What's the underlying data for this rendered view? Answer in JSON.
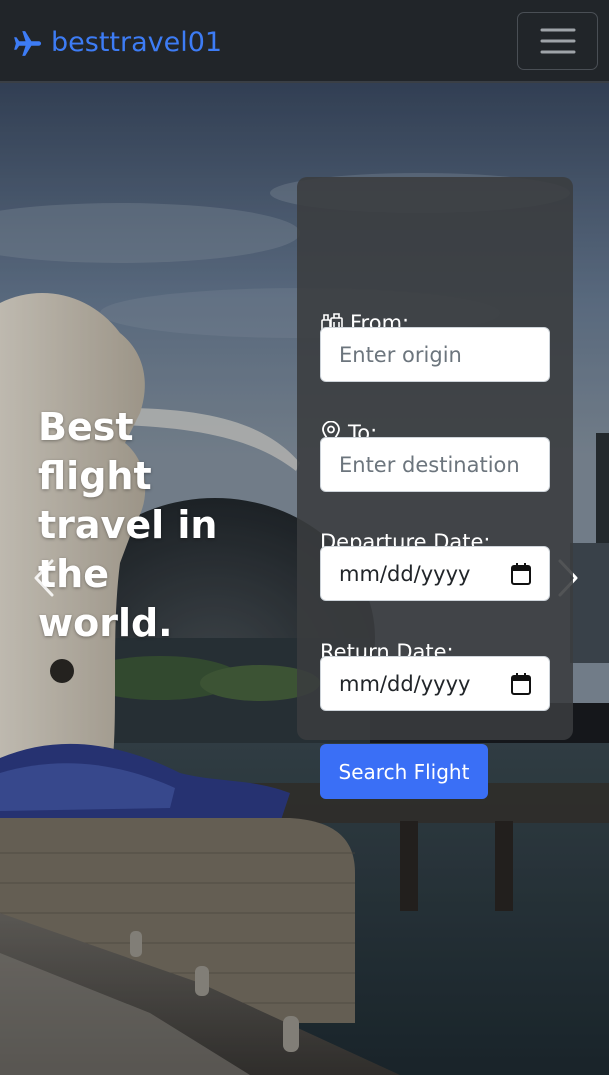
{
  "navbar": {
    "brand_text": "besttravel01",
    "brand_icon": "plane-icon",
    "toggler_icon": "hamburger-menu-icon",
    "brand_color": "#3d7cf5",
    "background": "#212529"
  },
  "hero": {
    "tagline": "Best flight travel in the world.",
    "prev_icon": "chevron-left-icon",
    "next_icon": "chevron-right-icon"
  },
  "search_form": {
    "from": {
      "label": "From:",
      "icon": "luggage-icon",
      "placeholder": "Enter origin"
    },
    "to": {
      "label": "To:",
      "icon": "location-pin-icon",
      "placeholder": "Enter destination"
    },
    "departure": {
      "label": "Departure Date:",
      "value": "mm/dd/yyyy",
      "icon": "calendar-icon"
    },
    "return": {
      "label": "Return Date:",
      "value": "mm/dd/yyyy",
      "icon": "calendar-icon"
    },
    "submit_label": "Search Flight",
    "submit_color": "#3a6ff6"
  }
}
